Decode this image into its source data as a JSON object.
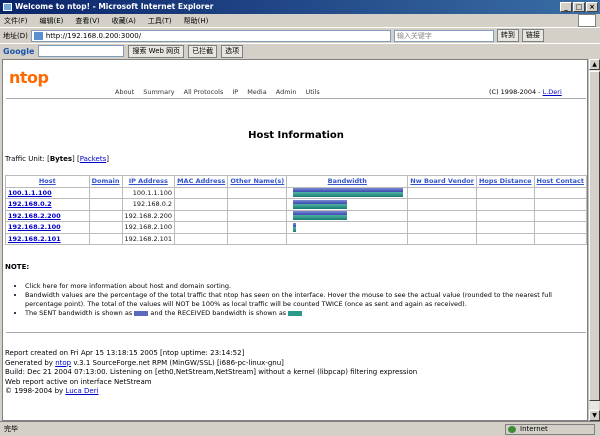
{
  "window": {
    "title": "Welcome to ntop! - Microsoft Internet Explorer",
    "buttons": [
      "_",
      "□",
      "×"
    ]
  },
  "menu": [
    "文件(F)",
    "编辑(E)",
    "查看(V)",
    "收藏(A)",
    "工具(T)",
    "帮助(H)"
  ],
  "address": {
    "label": "地址(D)",
    "url": "http://192.168.0.200:3000/",
    "search_placeholder": "输入关键字",
    "go": "转到",
    "links": "链接"
  },
  "google": {
    "logo": "Google",
    "search_btn": "搜索 Web 网页",
    "blocked": "已拦截",
    "options": "选项"
  },
  "header": {
    "logo": "ntop",
    "nav": [
      "About",
      "Summary",
      "All Protocols",
      "IP",
      "Media",
      "Admin",
      "Utils"
    ],
    "copyright": "(C) 1998-2004 - ",
    "author": "L.Deri"
  },
  "main": {
    "title": "Host Information",
    "traffic_label": "Traffic Unit: [",
    "traffic_bytes": "Bytes",
    "traffic_mid": "] [",
    "traffic_packets": "Packets",
    "traffic_end": "]"
  },
  "table": {
    "columns": [
      "Host",
      "Domain",
      "IP Address",
      "MAC Address",
      "Other Name(s)",
      "Bandwidth",
      "Nw Board Vendor",
      "Hops Distance",
      "Host Contact"
    ],
    "rows": [
      {
        "host": "100.1.1.100",
        "ip": "100.1.1.100",
        "sent": 0.98,
        "rcvd": 0.98
      },
      {
        "host": "192.168.0.2",
        "ip": "192.168.0.2",
        "sent": 0.48,
        "rcvd": 0.48
      },
      {
        "host": "192.168.2.200",
        "ip": "192.168.2.200",
        "sent": 0.48,
        "rcvd": 0.48
      },
      {
        "host": "192.168.2.100",
        "ip": "192.168.2.100",
        "sent": 0.03,
        "rcvd": 0.03
      },
      {
        "host": "192.168.2.101",
        "ip": "192.168.2.101",
        "sent": 0,
        "rcvd": 0
      }
    ]
  },
  "notes": {
    "title": "NOTE:",
    "items": [
      "Click here for more information about host and domain sorting.",
      "Bandwidth values are the percentage of the total traffic that ntop has seen on the interface. Hover the mouse to see the actual value (rounded to the nearest full percentage point). The total of the values will NOT be 100% as local traffic will be counted TWICE (once as sent and again as received).",
      "The SENT bandwidth is shown as",
      "and the RECEIVED bandwidth is shown as"
    ]
  },
  "report": {
    "created": "Report created on Fri Apr 15 13:18:15 2005 [ntop uptime: 23:14:52]",
    "generated_pre": "Generated by ",
    "generated_link": "ntop",
    "generated_post": " v.3.1 SourceForge.net RPM (MinGW/SSL) [i686-pc-linux-gnu]",
    "build": "Build: Dec 21 2004 07:13:00. Listening on [eth0,NetStream,NetStream] without a kernel (libpcap) filtering expression",
    "web": "Web report active on interface NetStream",
    "copy_pre": "© 1998-2004 by ",
    "copy_link": "Luca Deri"
  },
  "status": {
    "left": "完毕",
    "zone": "Internet"
  }
}
